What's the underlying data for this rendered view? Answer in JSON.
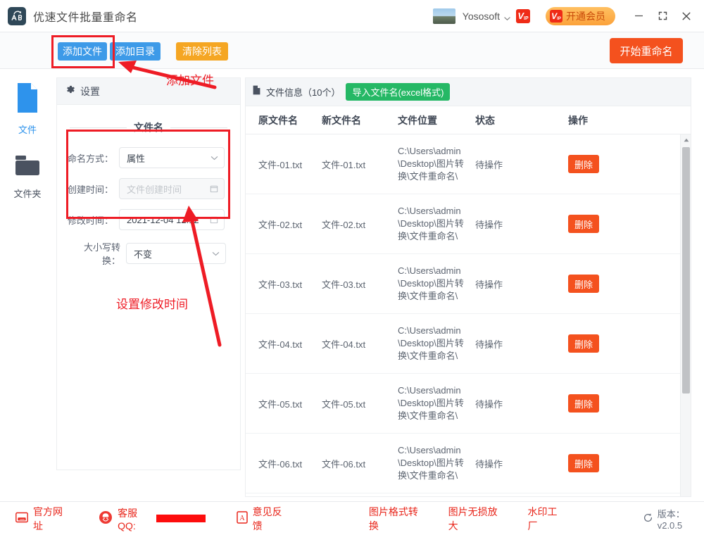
{
  "window": {
    "app_title": "优速文件批量重命名",
    "logo_icon": "ab-rename-icon",
    "user_name": "Yososoft",
    "user_chevron_icon": "chevron-down-icon",
    "vip_badge_icon": "vip-badge-icon",
    "vip_v": "V",
    "vip_ip": "IP",
    "vip_button_label": "开通会员",
    "minimize_icon": "minimize-icon",
    "maximize_icon": "maximize-icon",
    "close_icon": "close-icon"
  },
  "toolbar": {
    "add_file": "添加文件",
    "add_dir": "添加目录",
    "clear_list": "清除列表",
    "start_rename": "开始重命名"
  },
  "sidebar": {
    "items": [
      {
        "label": "文件",
        "icon": "file-icon",
        "active": true
      },
      {
        "label": "文件夹",
        "icon": "folder-icon",
        "active": false
      }
    ]
  },
  "settings": {
    "header_icon": "gear-icon",
    "header_title": "设置",
    "section_title": "文件名",
    "fields": [
      {
        "label": "命名方式：",
        "type": "select",
        "value": "属性",
        "placeholder": "",
        "icon": "chevron-down-icon",
        "disabled": false
      },
      {
        "label": "创建时间：",
        "type": "date",
        "value": "",
        "placeholder": "文件创建时间",
        "icon": "calendar-icon",
        "disabled": true
      },
      {
        "label": "修改时间：",
        "type": "date",
        "value": "2021-12-04 12:12",
        "placeholder": "",
        "icon": "calendar-icon",
        "disabled": false
      },
      {
        "label": "大小写转换：",
        "type": "select",
        "value": "不变",
        "placeholder": "",
        "icon": "chevron-down-icon",
        "disabled": false
      }
    ]
  },
  "file_panel": {
    "header_icon": "file-icon",
    "header_title": "文件信息（10个）",
    "import_button": "导入文件名(excel格式)",
    "columns": [
      "原文件名",
      "新文件名",
      "文件位置",
      "状态",
      "操作"
    ],
    "rows": [
      {
        "original": "文件-01.txt",
        "new_name": "文件-01.txt",
        "location": "C:\\Users\\admin\\Desktop\\图片转换\\文件重命名\\",
        "status": "待操作",
        "action": "删除"
      },
      {
        "original": "文件-02.txt",
        "new_name": "文件-02.txt",
        "location": "C:\\Users\\admin\\Desktop\\图片转换\\文件重命名\\",
        "status": "待操作",
        "action": "删除"
      },
      {
        "original": "文件-03.txt",
        "new_name": "文件-03.txt",
        "location": "C:\\Users\\admin\\Desktop\\图片转换\\文件重命名\\",
        "status": "待操作",
        "action": "删除"
      },
      {
        "original": "文件-04.txt",
        "new_name": "文件-04.txt",
        "location": "C:\\Users\\admin\\Desktop\\图片转换\\文件重命名\\",
        "status": "待操作",
        "action": "删除"
      },
      {
        "original": "文件-05.txt",
        "new_name": "文件-05.txt",
        "location": "C:\\Users\\admin\\Desktop\\图片转换\\文件重命名\\",
        "status": "待操作",
        "action": "删除"
      },
      {
        "original": "文件-06.txt",
        "new_name": "文件-06.txt",
        "location": "C:\\Users\\admin\\Desktop\\图片转换\\文件重命名\\",
        "status": "待操作",
        "action": "删除"
      }
    ],
    "scroll_up_icon": "triangle-up-icon",
    "scroll_down_icon": "triangle-down-icon"
  },
  "bottom_bar": {
    "website": {
      "label": "官方网址",
      "icon": "com-box-icon"
    },
    "qq": {
      "label": "客服QQ:",
      "icon": "headset-icon",
      "value_redacted": true
    },
    "feedback": {
      "label": "意见反馈",
      "icon": "pdf-icon"
    },
    "links": [
      "图片格式转换",
      "图片无损放大",
      "水印工厂"
    ],
    "version": "版本：v2.0.5",
    "version_icon": "refresh-icon"
  },
  "annotations": {
    "add_file_label": "添加文件",
    "mod_time_label": "设置修改时间",
    "color": "#ee1c25"
  }
}
